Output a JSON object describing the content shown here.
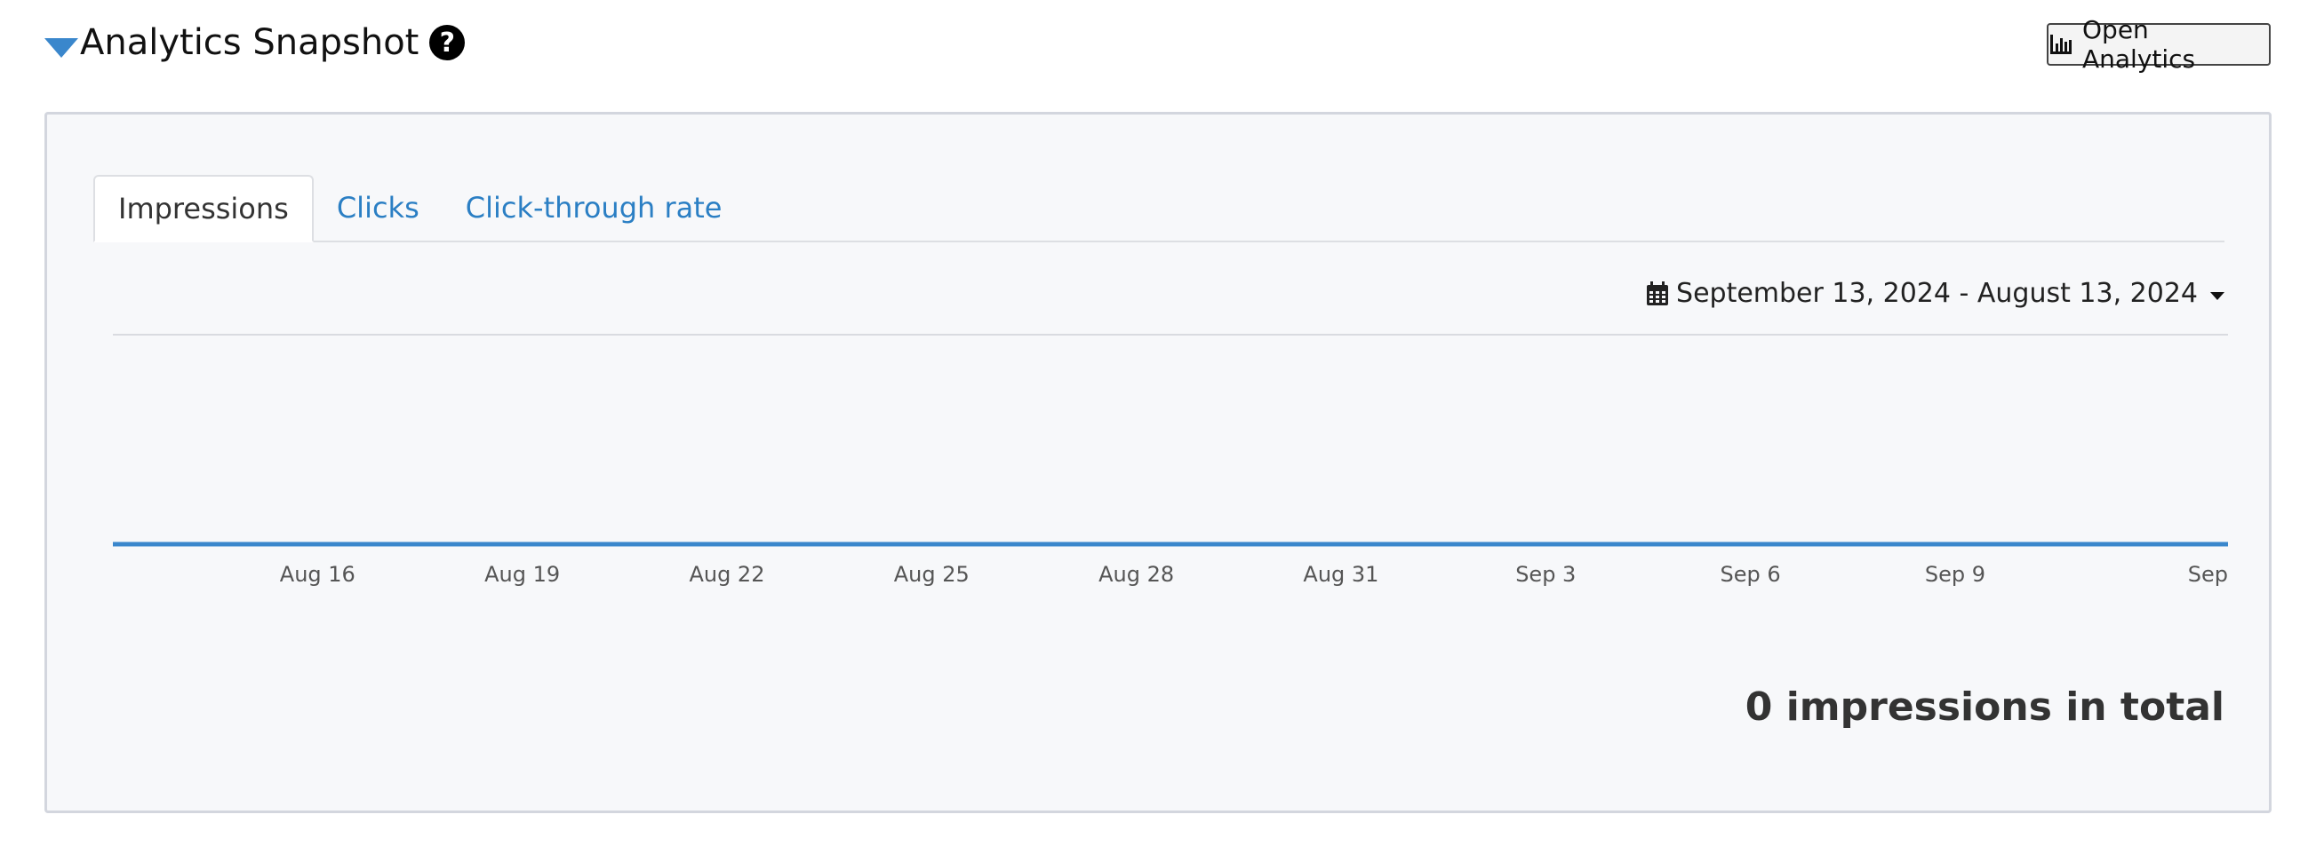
{
  "header": {
    "title": "Analytics Snapshot",
    "help_symbol": "?",
    "open_analytics_label": "Open Analytics"
  },
  "tabs": [
    {
      "label": "Impressions",
      "active": true
    },
    {
      "label": "Clicks",
      "active": false
    },
    {
      "label": "Click-through rate",
      "active": false
    }
  ],
  "date_range": {
    "label": "September 13, 2024 - August 13, 2024"
  },
  "summary": {
    "total_text": "0 impressions in total"
  },
  "colors": {
    "accent": "#3a87cc",
    "tab_link": "#2b7fc4",
    "panel_bg": "#f7f8fa"
  },
  "icons": {
    "toggle": "caret-down-icon",
    "help": "question-circle-icon",
    "analytics": "bar-chart-icon",
    "calendar": "calendar-icon"
  },
  "chart_data": {
    "type": "line",
    "x_ticks": [
      "Aug 16",
      "Aug 19",
      "Aug 22",
      "Aug 25",
      "Aug 28",
      "Aug 31",
      "Sep 3",
      "Sep 6",
      "Sep 9",
      "Sep"
    ],
    "x": [
      "Aug 13",
      "Aug 14",
      "Aug 15",
      "Aug 16",
      "Aug 17",
      "Aug 18",
      "Aug 19",
      "Aug 20",
      "Aug 21",
      "Aug 22",
      "Aug 23",
      "Aug 24",
      "Aug 25",
      "Aug 26",
      "Aug 27",
      "Aug 28",
      "Aug 29",
      "Aug 30",
      "Aug 31",
      "Sep 1",
      "Sep 2",
      "Sep 3",
      "Sep 4",
      "Sep 5",
      "Sep 6",
      "Sep 7",
      "Sep 8",
      "Sep 9",
      "Sep 10",
      "Sep 11",
      "Sep 12",
      "Sep 13"
    ],
    "series": [
      {
        "values": [
          0,
          0,
          0,
          0,
          0,
          0,
          0,
          0,
          0,
          0,
          0,
          0,
          0,
          0,
          0,
          0,
          0,
          0,
          0,
          0,
          0,
          0,
          0,
          0,
          0,
          0,
          0,
          0,
          0,
          0,
          0,
          0
        ]
      }
    ],
    "title": "",
    "xlabel": "",
    "ylabel": "",
    "grid": true,
    "line_color": "#3a87cc"
  }
}
